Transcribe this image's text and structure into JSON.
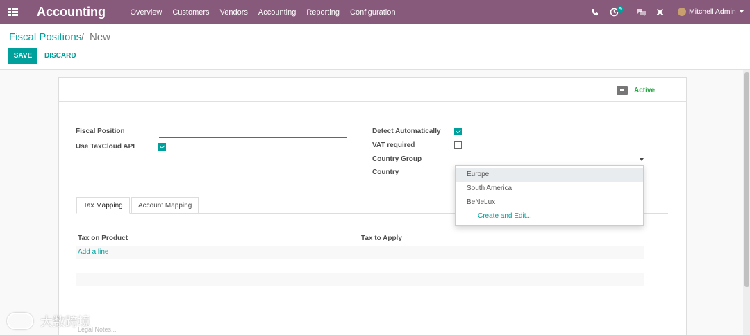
{
  "navbar": {
    "app_title": "Accounting",
    "menu": [
      "Overview",
      "Customers",
      "Vendors",
      "Accounting",
      "Reporting",
      "Configuration"
    ],
    "activity_count": "9",
    "user_name": "Mitchell Admin",
    "icons": [
      "apps-icon",
      "phone-icon",
      "activity-icon",
      "chat-icon",
      "close-icon"
    ],
    "bg_color": "#875a7b"
  },
  "breadcrumb": {
    "parent": "Fiscal Positions",
    "separator": "/",
    "current": "New"
  },
  "buttons": {
    "save": "SAVE",
    "discard": "DISCARD"
  },
  "status": {
    "active_label": "Active"
  },
  "form": {
    "fiscal_position_label": "Fiscal Position",
    "fiscal_position_value": "",
    "use_taxcloud_label": "Use TaxCloud API",
    "use_taxcloud_checked": true,
    "detect_auto_label": "Detect Automatically",
    "detect_auto_checked": true,
    "vat_required_label": "VAT required",
    "vat_required_checked": false,
    "country_group_label": "Country Group",
    "country_label": "Country"
  },
  "dropdown": {
    "options": [
      "Europe",
      "South America",
      "BeNeLux"
    ],
    "highlighted": "Europe",
    "create_label": "Create and Edit..."
  },
  "tabs": [
    "Tax Mapping",
    "Account Mapping"
  ],
  "tax_table": {
    "columns": [
      "Tax on Product",
      "Tax to Apply"
    ],
    "add_line": "Add a line"
  },
  "legal_notes_placeholder": "Legal Notes...",
  "watermark": "大数跨境",
  "accent_color": "#00a09d"
}
